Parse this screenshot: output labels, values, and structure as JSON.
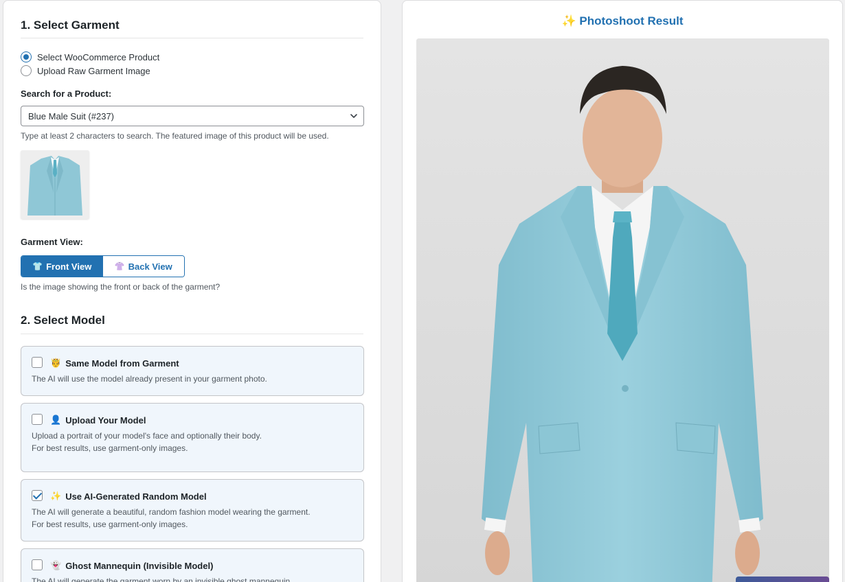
{
  "left": {
    "section1_title": "1. Select Garment",
    "source_options": [
      {
        "label": "Select WooCommerce Product",
        "checked": true
      },
      {
        "label": "Upload Raw Garment Image",
        "checked": false
      }
    ],
    "search_label": "Search for a Product:",
    "product_value": "Blue Male Suit (#237)",
    "search_help": "Type at least 2 characters to search. The featured image of this product will be used.",
    "garment_view_label": "Garment View:",
    "front_view_label": "Front View",
    "back_view_label": "Back View",
    "front_view_icon": "👕",
    "back_view_icon": "👚",
    "garment_view_help": "Is the image showing the front or back of the garment?",
    "section2_title": "2. Select Model",
    "model_options": [
      {
        "icon": "🤴",
        "title": "Same Model from Garment",
        "desc1": "The AI will use the model already present in your garment photo.",
        "desc2": "",
        "checked": false
      },
      {
        "icon": "👤",
        "title": "Upload Your Model",
        "desc1": "Upload a portrait of your model's face and optionally their body.",
        "desc2": "For best results, use garment-only images.",
        "checked": false
      },
      {
        "icon": "✨",
        "title": "Use AI-Generated Random Model",
        "desc1": "The AI will generate a beautiful, random fashion model wearing the garment.",
        "desc2": "For best results, use garment-only images.",
        "checked": true
      },
      {
        "icon": "👻",
        "title": "Ghost Mannequin (Invisible Model)",
        "desc1": "The AI will generate the garment worn by an invisible ghost mannequin.",
        "desc2": "",
        "checked": false
      }
    ]
  },
  "right": {
    "result_title": "✨ Photoshoot Result"
  },
  "colors": {
    "accent": "#2271b1",
    "suit": "#8fc7d6",
    "card_bg": "#f0f6fc"
  }
}
